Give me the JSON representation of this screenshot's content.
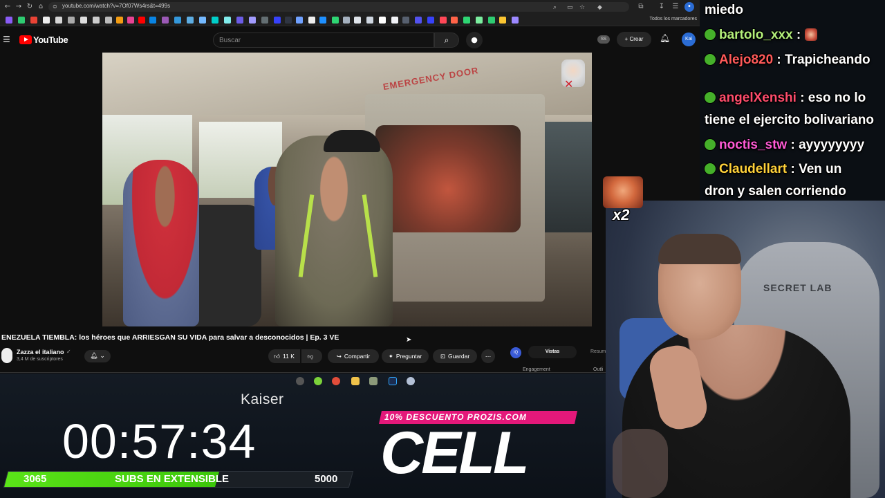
{
  "browser": {
    "url": "youtube.com/watch?v=7Of07Ws4rs&t=499s",
    "bookmarks_folder": "Todos los marcadores"
  },
  "youtube": {
    "brand": "YouTube",
    "search_placeholder": "Buscar",
    "badge_ss": "SS",
    "create_label": "+ Crear",
    "avatar_label": "Kai",
    "video": {
      "overlay_text": "EMERGENCY DOOR",
      "title": "ENEZUELA TIEMBLA: los héroes que ARRIESGAN SU VIDA para salvar a desconocidos | Ep. 3 VE",
      "channel_name": "Zazza el italiano",
      "verified_icon": "✓",
      "subscribers": "3,4 M de suscriptores",
      "likes": "11 K",
      "share_label": "Compartir",
      "ask_label": "Preguntar",
      "save_label": "Guardar"
    },
    "extension": {
      "icon_label": "IQ",
      "tab_views": "Vistas",
      "tab_summary": "Resum",
      "engagement": "Engagement",
      "outline": "Outli"
    }
  },
  "overlay": {
    "brand": "Kaiser",
    "timer": "00:57:34",
    "subs_current": "3065",
    "subs_label": "SUBS EN EXTENSIBLE",
    "subs_goal": "5000",
    "subs_progress": 0.613,
    "promo": "10% DESCUENTO PROZIS.COM",
    "cell": "CELL"
  },
  "chat": {
    "messages": [
      {
        "user": "",
        "text": "miedo"
      },
      {
        "user": "bartolo_xxx",
        "user_color": "#b4f07a",
        "text": " : "
      },
      {
        "user": "Alejo820",
        "user_color": "#ff5a5a",
        "text": " : Trapicheando"
      },
      {
        "user": "angelXenshi",
        "user_color": "#ff4d6d",
        "text": " : eso no lo"
      },
      {
        "user": "",
        "text": "tiene el ejercito bolivariano"
      },
      {
        "user": "noctis_stw",
        "user_color": "#ff5ad6",
        "text": " : ayyyyyyyy"
      },
      {
        "user": "Claudellart",
        "user_color": "#ffd23a",
        "text": " : Ven un"
      },
      {
        "user": "",
        "text": "dron y salen corriendo"
      }
    ],
    "emote_count": "x2"
  },
  "webcam": {
    "chair_brand": "SECRET LAB"
  },
  "icons": {
    "menu": "hamburger-icon",
    "search": "search-icon",
    "mic": "mic-icon",
    "bell": "bell-icon",
    "like": "thumbs-up-icon",
    "dislike": "thumbs-down-icon",
    "share": "share-icon",
    "ask": "sparkle-icon",
    "save": "bookmark-icon",
    "more": "more-icon"
  }
}
